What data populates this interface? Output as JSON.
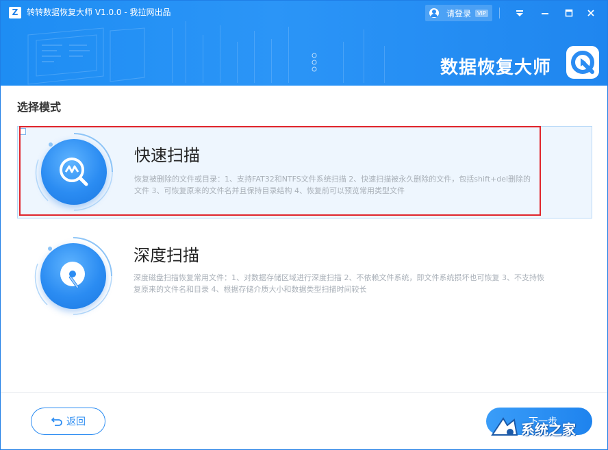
{
  "window": {
    "logo_letter": "Z",
    "title": "转转数据恢复大师 V1.0.0 - 我拉网出品"
  },
  "account": {
    "login_label": "请登录",
    "vip_badge": "VIP"
  },
  "window_controls": {
    "icons": [
      "menu-icon",
      "minimize-icon",
      "maximize-icon",
      "close-icon"
    ]
  },
  "brand": {
    "text": "数据恢复大师"
  },
  "main": {
    "section_title": "选择模式",
    "modes": [
      {
        "title": "快速扫描",
        "description": "恢复被删除的文件或目录：1、支持FAT32和NTFS文件系统扫描 2、快速扫描被永久删除的文件，包括shift+del删除的文件 3、可恢复原来的文件名并且保持目录结构 4、恢复前可以预览常用类型文件",
        "selected": true,
        "icon": "quick-scan-icon"
      },
      {
        "title": "深度扫描",
        "description": "深度磁盘扫描恢复常用文件：1、对数据存储区域进行深度扫描 2、不依赖文件系统，即文件系统损坏也可恢复 3、不支持恢复原来的文件名和目录 4、根据存储介质大小和数据类型扫描时间较长",
        "selected": false,
        "icon": "deep-scan-icon"
      }
    ]
  },
  "footer": {
    "back_label": "返回",
    "next_label": "下一步"
  },
  "watermark": {
    "text": "系统之家"
  },
  "colors": {
    "primary": "#2b8cf2",
    "selected_bg": "#eef6fe",
    "highlight": "#e0242b"
  }
}
